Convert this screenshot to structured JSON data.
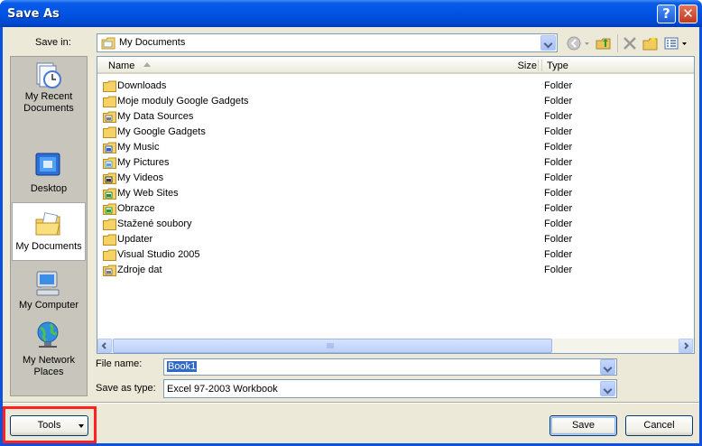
{
  "window": {
    "title": "Save As",
    "help_glyph": "?",
    "close_glyph": "✕"
  },
  "save_in": {
    "label": "Save in:",
    "value": "My Documents"
  },
  "toolbar": {
    "icons": [
      "back-icon",
      "up-folder-icon",
      "delete-icon",
      "new-folder-icon",
      "views-icon"
    ]
  },
  "places": [
    {
      "label": "My Recent\nDocuments",
      "icon": "recent-documents-icon"
    },
    {
      "label": "Desktop",
      "icon": "desktop-icon"
    },
    {
      "label": "My Documents",
      "icon": "my-documents-icon",
      "active": true
    },
    {
      "label": "My Computer",
      "icon": "my-computer-icon"
    },
    {
      "label": "My Network\nPlaces",
      "icon": "network-places-icon"
    }
  ],
  "file_list": {
    "columns": {
      "name": "Name",
      "size": "Size",
      "type": "Type"
    },
    "rows": [
      {
        "name": "Downloads",
        "type": "Folder",
        "icon": "folder"
      },
      {
        "name": "Moje moduly Google Gadgets",
        "type": "Folder",
        "icon": "folder"
      },
      {
        "name": "My Data Sources",
        "type": "Folder",
        "icon": "data-folder"
      },
      {
        "name": "My Google Gadgets",
        "type": "Folder",
        "icon": "folder"
      },
      {
        "name": "My Music",
        "type": "Folder",
        "icon": "music-folder"
      },
      {
        "name": "My Pictures",
        "type": "Folder",
        "icon": "pictures-folder"
      },
      {
        "name": "My Videos",
        "type": "Folder",
        "icon": "videos-folder"
      },
      {
        "name": "My Web Sites",
        "type": "Folder",
        "icon": "web-folder"
      },
      {
        "name": "Obrazce",
        "type": "Folder",
        "icon": "shapes-folder"
      },
      {
        "name": "Stažené soubory",
        "type": "Folder",
        "icon": "folder"
      },
      {
        "name": "Updater",
        "type": "Folder",
        "icon": "folder"
      },
      {
        "name": "Visual Studio 2005",
        "type": "Folder",
        "icon": "folder"
      },
      {
        "name": "Zdroje dat",
        "type": "Folder",
        "icon": "data-folder"
      }
    ]
  },
  "file_name": {
    "label": "File name:",
    "value": "Book1"
  },
  "save_as_type": {
    "label": "Save as type:",
    "value": "Excel 97-2003 Workbook"
  },
  "buttons": {
    "tools": "Tools",
    "save": "Save",
    "cancel": "Cancel"
  },
  "colors": {
    "titlebar": "#0054e3",
    "dialog_bg": "#ece9d8",
    "selection": "#316ac5",
    "highlight_box": "#ff2020"
  }
}
